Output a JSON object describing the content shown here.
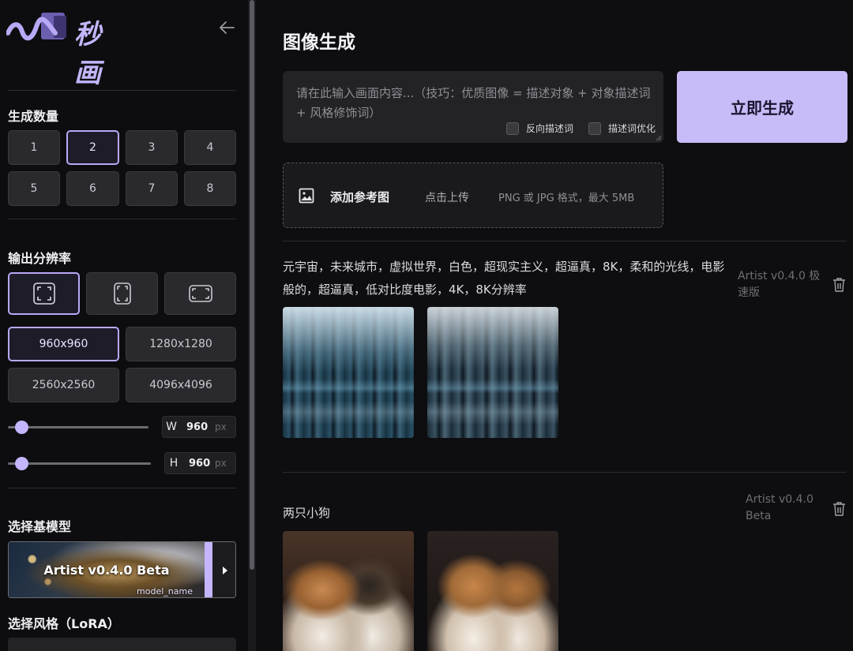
{
  "app": {
    "logo_text": "秒画"
  },
  "sidebar": {
    "count_title": "生成数量",
    "counts": [
      "1",
      "2",
      "3",
      "4",
      "5",
      "6",
      "7",
      "8"
    ],
    "selected_count": "2",
    "resolution_title": "输出分辨率",
    "aspect_ratios": [
      "square",
      "portrait",
      "landscape"
    ],
    "resolutions": [
      "960x960",
      "1280x1280",
      "2560x2560",
      "4096x4096"
    ],
    "selected_resolution": "960x960",
    "width": {
      "label": "W",
      "value": "960",
      "unit": "px"
    },
    "height": {
      "label": "H",
      "value": "960",
      "unit": "px"
    },
    "model_title": "选择基模型",
    "model": {
      "name": "Artist v0.4.0 Beta",
      "subtitle": "model_name"
    },
    "lora_title": "选择风格（LoRA）"
  },
  "main": {
    "title": "图像生成",
    "prompt_placeholder": "请在此输入画面内容...（技巧：优质图像 = 描述对象 + 对象描述词 + 风格修饰词）",
    "negative_prompt_label": "反向描述词",
    "prompt_optimize_label": "描述词优化",
    "generate_button": "立即生成",
    "upload": {
      "title": "添加参考图",
      "action": "点击上传",
      "hint": "PNG 或 JPG 格式，最大 5MB"
    }
  },
  "results": [
    {
      "prompt": "元宇宙，未来城市，虚拟世界，白色，超现实主义，超逼真，8K，柔和的光线，电影般的，超逼真，低对比度电影，4K，8K分辨率",
      "model": "Artist v0.4.0 极速版",
      "images": [
        "futuristic-city-1",
        "futuristic-city-2"
      ]
    },
    {
      "prompt": "两只小狗",
      "model": "Artist v0.4.0 Beta",
      "images": [
        "two-puppies-1",
        "two-puppies-2"
      ]
    }
  ],
  "colors": {
    "accent": "#c4b5fd",
    "background": "#0e0e10",
    "panel": "#232326"
  }
}
